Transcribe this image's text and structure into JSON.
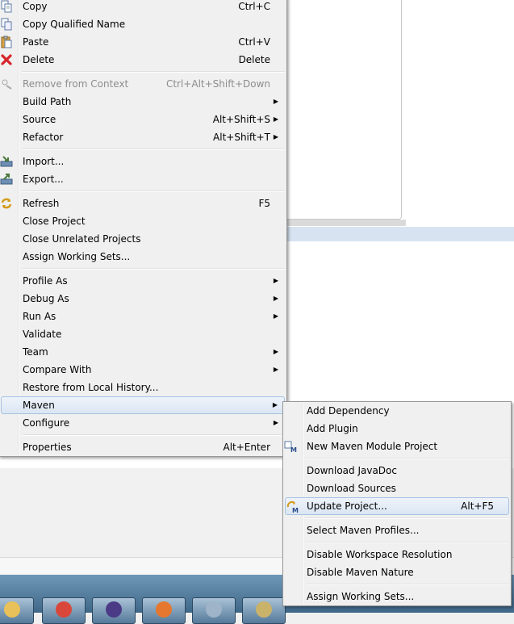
{
  "context_menu": {
    "items": [
      {
        "type": "item",
        "label": "Copy",
        "shortcut": "Ctrl+C",
        "icon": "copy-icon"
      },
      {
        "type": "item",
        "label": "Copy Qualified Name",
        "shortcut": "",
        "icon": "copy-qualified-icon"
      },
      {
        "type": "item",
        "label": "Paste",
        "shortcut": "Ctrl+V",
        "icon": "paste-icon"
      },
      {
        "type": "item",
        "label": "Delete",
        "shortcut": "Delete",
        "icon": "delete-icon"
      },
      {
        "type": "sep"
      },
      {
        "type": "item",
        "label": "Remove from Context",
        "shortcut": "Ctrl+Alt+Shift+Down",
        "icon": "remove-context-icon",
        "disabled": true
      },
      {
        "type": "item",
        "label": "Build Path",
        "shortcut": "",
        "submenu": true
      },
      {
        "type": "item",
        "label": "Source",
        "shortcut": "Alt+Shift+S",
        "submenu": true
      },
      {
        "type": "item",
        "label": "Refactor",
        "shortcut": "Alt+Shift+T",
        "submenu": true
      },
      {
        "type": "sep"
      },
      {
        "type": "item",
        "label": "Import...",
        "shortcut": "",
        "icon": "import-icon"
      },
      {
        "type": "item",
        "label": "Export...",
        "shortcut": "",
        "icon": "export-icon"
      },
      {
        "type": "sep"
      },
      {
        "type": "item",
        "label": "Refresh",
        "shortcut": "F5",
        "icon": "refresh-icon"
      },
      {
        "type": "item",
        "label": "Close Project",
        "shortcut": ""
      },
      {
        "type": "item",
        "label": "Close Unrelated Projects",
        "shortcut": ""
      },
      {
        "type": "item",
        "label": "Assign Working Sets...",
        "shortcut": ""
      },
      {
        "type": "sep"
      },
      {
        "type": "item",
        "label": "Profile As",
        "shortcut": "",
        "submenu": true
      },
      {
        "type": "item",
        "label": "Debug As",
        "shortcut": "",
        "submenu": true
      },
      {
        "type": "item",
        "label": "Run As",
        "shortcut": "",
        "submenu": true
      },
      {
        "type": "item",
        "label": "Validate",
        "shortcut": ""
      },
      {
        "type": "item",
        "label": "Team",
        "shortcut": "",
        "submenu": true
      },
      {
        "type": "item",
        "label": "Compare With",
        "shortcut": "",
        "submenu": true
      },
      {
        "type": "item",
        "label": "Restore from Local History...",
        "shortcut": ""
      },
      {
        "type": "item",
        "label": "Maven",
        "shortcut": "",
        "submenu": true,
        "highlighted": true
      },
      {
        "type": "item",
        "label": "Configure",
        "shortcut": "",
        "submenu": true
      },
      {
        "type": "sep"
      },
      {
        "type": "item",
        "label": "Properties",
        "shortcut": "Alt+Enter"
      }
    ]
  },
  "maven_submenu": {
    "items": [
      {
        "type": "item",
        "label": "Add Dependency",
        "shortcut": ""
      },
      {
        "type": "item",
        "label": "Add Plugin",
        "shortcut": ""
      },
      {
        "type": "item",
        "label": "New Maven Module Project",
        "shortcut": "",
        "icon": "maven-module-icon"
      },
      {
        "type": "sep"
      },
      {
        "type": "item",
        "label": "Download JavaDoc",
        "shortcut": ""
      },
      {
        "type": "item",
        "label": "Download Sources",
        "shortcut": ""
      },
      {
        "type": "item",
        "label": "Update Project...",
        "shortcut": "Alt+F5",
        "icon": "maven-update-icon",
        "highlighted": true
      },
      {
        "type": "sep"
      },
      {
        "type": "item",
        "label": "Select Maven Profiles...",
        "shortcut": ""
      },
      {
        "type": "sep"
      },
      {
        "type": "item",
        "label": "Disable Workspace Resolution",
        "shortcut": ""
      },
      {
        "type": "item",
        "label": "Disable Maven Nature",
        "shortcut": ""
      },
      {
        "type": "sep"
      },
      {
        "type": "item",
        "label": "Assign Working Sets...",
        "shortcut": ""
      }
    ]
  },
  "taskbar": {
    "buttons": [
      {
        "icon": "windows-explorer-icon",
        "color": "#e9c15a"
      },
      {
        "icon": "chrome-icon",
        "color": "#d9473a"
      },
      {
        "icon": "eclipse-icon",
        "color": "#4b3b86"
      },
      {
        "icon": "firefox-icon",
        "color": "#e6772e"
      },
      {
        "icon": "mysql-icon",
        "color": "#9fb4c8"
      },
      {
        "icon": "paint-icon",
        "color": "#c9b36a"
      }
    ]
  },
  "colors": {
    "highlight_border": "#a8c3e2",
    "menu_bg": "#f0f0f0"
  }
}
